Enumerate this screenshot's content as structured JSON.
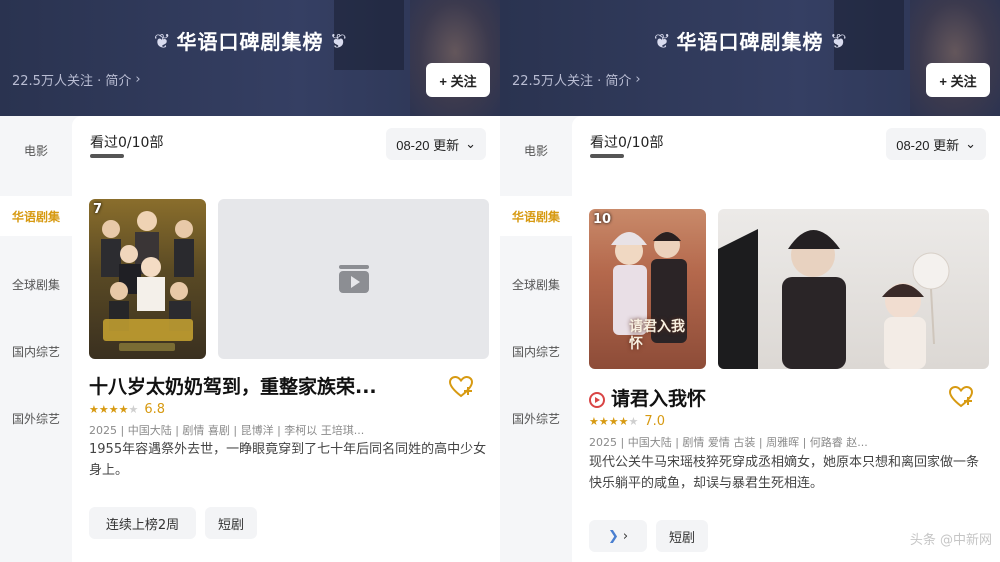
{
  "header": {
    "title": "华语口碑剧集榜",
    "followers": "22.5万人关注 · 简介",
    "follow_button": "+ 关注"
  },
  "sidebar": {
    "items": [
      {
        "label": "电影"
      },
      {
        "label": "华语剧集"
      },
      {
        "label": "全球剧集"
      },
      {
        "label": "国内综艺"
      },
      {
        "label": "国外综艺"
      }
    ]
  },
  "content": {
    "watched": "看过0/10部",
    "update": "08-20 更新"
  },
  "left_card": {
    "rank": "7",
    "title": "十八岁太奶奶驾到，重整家族荣...",
    "score": "6.8",
    "meta": "2025 | 中国大陆 | 剧情 喜剧 | 昆博洋 | 李柯以 王培琪...",
    "description": "1955年容遇祭外去世，一睁眼竟穿到了七十年后同名同姓的高中少女身上。",
    "tags": [
      "连续上榜2周",
      "短剧"
    ],
    "colors": {
      "poster_bg": "#6b5a2e"
    }
  },
  "right_card": {
    "rank": "10",
    "title": "请君入我怀",
    "score": "7.0",
    "meta": "2025 | 中国大陆 | 剧情 爱情 古装 | 周雅晖 | 何路睿 赵...",
    "description": "现代公关牛马宋瑶枝猝死穿成丞相嫡女，她原本只想和离回家做一条快乐躺平的咸鱼，却误与暴君生死相连。",
    "tags": [
      "短剧"
    ],
    "poster_text": "请君入我怀"
  },
  "colors": {
    "accent": "#d79a12",
    "header": "#2f3857"
  },
  "watermark": "头条 @中新网"
}
